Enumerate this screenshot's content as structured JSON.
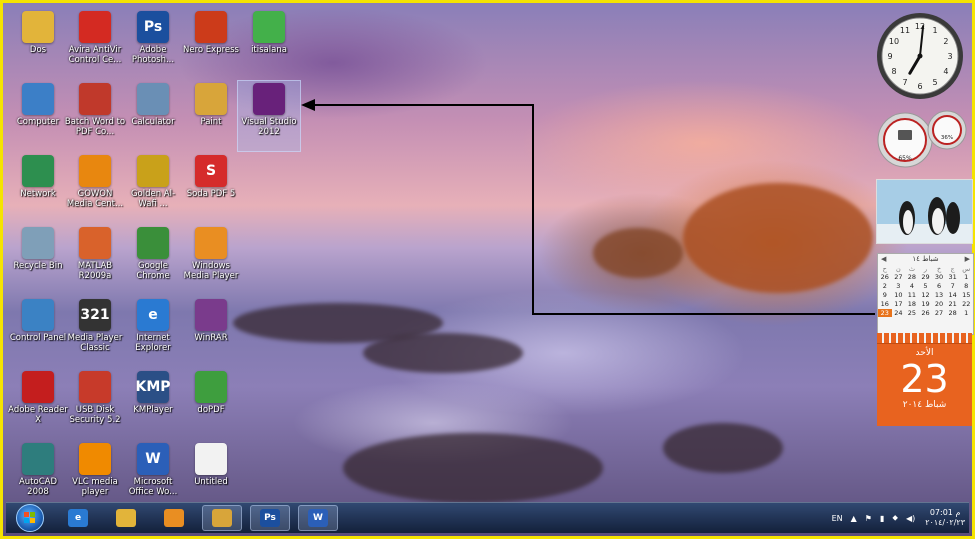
{
  "desktop": {
    "icons": [
      {
        "label": "Dos",
        "icon": "folder-icon",
        "color": "#e2b43a",
        "text": ""
      },
      {
        "label": "Avira AntiVir Control Ce...",
        "icon": "avira-icon",
        "color": "#d42a22",
        "text": ""
      },
      {
        "label": "Adobe Photosh...",
        "icon": "photoshop-icon",
        "color": "#1b4f9e",
        "text": "Ps"
      },
      {
        "label": "Nero Express",
        "icon": "nero-icon",
        "color": "#cc3b1a",
        "text": ""
      },
      {
        "label": "itisalana",
        "icon": "itisalana-icon",
        "color": "#43b04a",
        "text": ""
      },
      {
        "label": "Computer",
        "icon": "computer-icon",
        "color": "#3c7fc7",
        "text": ""
      },
      {
        "label": "Batch Word to PDF Co...",
        "icon": "batch-word-pdf-icon",
        "color": "#c0392b",
        "text": ""
      },
      {
        "label": "Calculator",
        "icon": "calculator-icon",
        "color": "#6a8fb5",
        "text": ""
      },
      {
        "label": "Paint",
        "icon": "paint-icon",
        "color": "#d8a53a",
        "text": ""
      },
      {
        "label": "Visual Studio 2012",
        "icon": "visual-studio-icon",
        "color": "#68217a",
        "text": ""
      },
      {
        "label": "Network",
        "icon": "network-icon",
        "color": "#2d8f4f",
        "text": ""
      },
      {
        "label": "GOWON Media Cent...",
        "icon": "gom-media-icon",
        "color": "#e8870f",
        "text": ""
      },
      {
        "label": "Golden Al-Wafi ...",
        "icon": "golden-al-wafi-icon",
        "color": "#c9a11a",
        "text": ""
      },
      {
        "label": "Soda PDF 5",
        "icon": "soda-pdf-icon",
        "color": "#d52b2b",
        "text": "S"
      },
      {
        "label": "Recycle Bin",
        "icon": "recycle-bin-icon",
        "color": "#7f9fb8",
        "text": ""
      },
      {
        "label": "MATLAB R2009a",
        "icon": "matlab-icon",
        "color": "#d9622b",
        "text": ""
      },
      {
        "label": "Google Chrome",
        "icon": "chrome-icon",
        "color": "#3a8f3a",
        "text": ""
      },
      {
        "label": "Windows Media Player",
        "icon": "media-player-icon",
        "color": "#e98e22",
        "text": ""
      },
      {
        "label": "Control Panel",
        "icon": "control-panel-icon",
        "color": "#3b82c4",
        "text": ""
      },
      {
        "label": "Media Player Classic",
        "icon": "media-player-classic-icon",
        "color": "#333333",
        "text": "321"
      },
      {
        "label": "Internet Explorer",
        "icon": "internet-explorer-icon",
        "color": "#2a7ad2",
        "text": "e"
      },
      {
        "label": "WinRAR",
        "icon": "winrar-icon",
        "color": "#7a3b8c",
        "text": ""
      },
      {
        "label": "Adobe Reader X",
        "icon": "adobe-reader-icon",
        "color": "#c41e1e",
        "text": ""
      },
      {
        "label": "USB Disk Security 5.2",
        "icon": "usb-disk-security-icon",
        "color": "#c73a2a",
        "text": ""
      },
      {
        "label": "KMPlayer",
        "icon": "kmplayer-icon",
        "color": "#2b4f86",
        "text": "KMP"
      },
      {
        "label": "doPDF",
        "icon": "dopdf-icon",
        "color": "#3e9e3e",
        "text": ""
      },
      {
        "label": "AutoCAD 2008",
        "icon": "autocad-icon",
        "color": "#2e7d7d",
        "text": ""
      },
      {
        "label": "VLC media player",
        "icon": "vlc-icon",
        "color": "#f08a00",
        "text": ""
      },
      {
        "label": "Microsoft Office Wo...",
        "icon": "word-icon",
        "color": "#2b5fb8",
        "text": "W"
      },
      {
        "label": "Untitled",
        "icon": "untitled-file-icon",
        "color": "#f2f2f2",
        "text": ""
      }
    ]
  },
  "gadgets": {
    "clock": {
      "hour": 7,
      "minute": 1
    },
    "meter": {
      "cpu": "65%",
      "memory": "36%"
    },
    "calendar": {
      "month_title": "شباط ١٤",
      "weekdays": [
        "ح",
        "ن",
        "ث",
        "ر",
        "خ",
        "ج",
        "س"
      ],
      "days": [
        "26",
        "27",
        "28",
        "29",
        "30",
        "31",
        "1",
        "2",
        "3",
        "4",
        "5",
        "6",
        "7",
        "8",
        "9",
        "10",
        "11",
        "12",
        "13",
        "14",
        "15",
        "16",
        "17",
        "18",
        "19",
        "20",
        "21",
        "22",
        "23",
        "24",
        "25",
        "26",
        "27",
        "28",
        "1"
      ],
      "today": "23"
    },
    "date_card": {
      "weekday": "الأحد",
      "day": "23",
      "month": "شباط ٢٠١٤"
    }
  },
  "taskbar": {
    "buttons": [
      {
        "name": "ie-taskbar-button",
        "icon": "internet-explorer-icon",
        "text": "e",
        "color": "#2a7ad2"
      },
      {
        "name": "explorer-taskbar-button",
        "icon": "folder-icon",
        "text": "",
        "color": "#e2b43a"
      },
      {
        "name": "media-player-taskbar-button",
        "icon": "media-player-icon",
        "text": "",
        "color": "#e98e22"
      },
      {
        "name": "paint-taskbar-button",
        "icon": "paint-icon",
        "text": "",
        "color": "#d8a53a"
      },
      {
        "name": "photoshop-taskbar-button",
        "icon": "photoshop-icon",
        "text": "Ps",
        "color": "#1b4f9e"
      },
      {
        "name": "word-taskbar-button",
        "icon": "word-icon",
        "text": "W",
        "color": "#2b5fb8"
      }
    ],
    "tray": {
      "language": "EN",
      "time": "07:01 م",
      "date": "٢٠١٤/٠٢/٢٣"
    }
  }
}
